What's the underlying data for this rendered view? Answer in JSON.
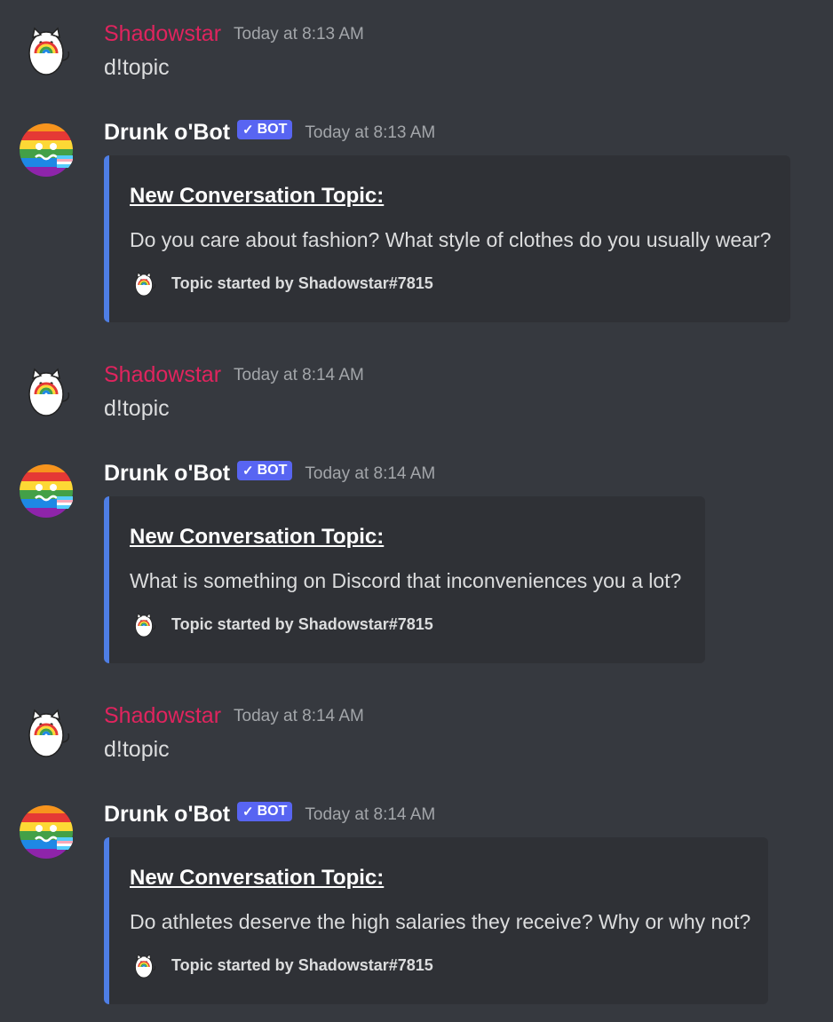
{
  "messages": [
    {
      "author": "Shadowstar",
      "timestamp": "Today at 8:13 AM",
      "content": "d!topic"
    },
    {
      "author": "Drunk o'Bot",
      "bot_tag": "BOT",
      "timestamp": "Today at 8:13 AM",
      "embed": {
        "title": "New Conversation Topic:",
        "description": "Do you care about fashion? What style of clothes do you usually wear?",
        "footer": "Topic started by Shadowstar#7815"
      }
    },
    {
      "author": "Shadowstar",
      "timestamp": "Today at 8:14 AM",
      "content": "d!topic"
    },
    {
      "author": "Drunk o'Bot",
      "bot_tag": "BOT",
      "timestamp": "Today at 8:14 AM",
      "embed": {
        "title": "New Conversation Topic:",
        "description": "What is something on Discord that inconveniences you a lot?",
        "footer": "Topic started by Shadowstar#7815"
      }
    },
    {
      "author": "Shadowstar",
      "timestamp": "Today at 8:14 AM",
      "content": "d!topic"
    },
    {
      "author": "Drunk o'Bot",
      "bot_tag": "BOT",
      "timestamp": "Today at 8:14 AM",
      "embed": {
        "title": "New Conversation Topic:",
        "description": "Do athletes deserve the high salaries they receive? Why or why not?",
        "footer": "Topic started by Shadowstar#7815"
      }
    }
  ],
  "colors": {
    "user_name": "#e0245e",
    "bot_tag": "#5865f2",
    "embed_bar": "#4e7ee5",
    "background": "#36393f",
    "embed_bg": "#2f3136"
  },
  "icons": {
    "user_avatar": "cat-rainbow-avatar-icon",
    "bot_avatar": "rainbow-face-avatar-icon",
    "verified": "checkmark-icon"
  }
}
